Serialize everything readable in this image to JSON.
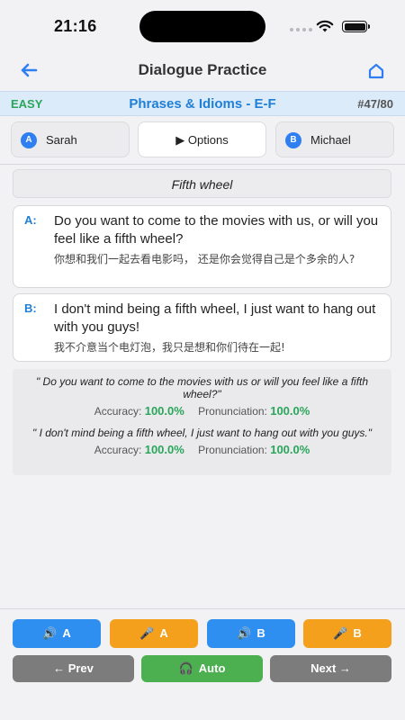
{
  "status": {
    "time": "21:16"
  },
  "header": {
    "title": "Dialogue Practice"
  },
  "level_bar": {
    "level": "EASY",
    "category": "Phrases & Idioms - E-F",
    "counter": "#47/80"
  },
  "tabs": {
    "a": {
      "badge": "A",
      "name": "Sarah"
    },
    "options": {
      "label": "▶ Options"
    },
    "b": {
      "badge": "B",
      "name": "Michael"
    }
  },
  "phrase": "Fifth wheel",
  "dialogue": [
    {
      "speaker": "A:",
      "english": "Do you want to come to the movies with us, or will you feel like a fifth wheel?",
      "chinese": "你想和我们一起去看电影吗， 还是你会觉得自己是个多余的人?"
    },
    {
      "speaker": "B:",
      "english": "I don't mind being a fifth wheel, I just want to hang out with you guys!",
      "chinese": "我不介意当个电灯泡，我只是想和你们待在一起!"
    }
  ],
  "results": [
    {
      "text": "\" Do you want to come to the movies with us or will you feel like a fifth wheel?\"",
      "accuracy_label": "Accuracy:",
      "accuracy": "100.0%",
      "pronunciation_label": "Pronunciation:",
      "pronunciation": "100.0%"
    },
    {
      "text": "\" I don't mind being a fifth wheel, I just want to hang out with you guys.\"",
      "accuracy_label": "Accuracy:",
      "accuracy": "100.0%",
      "pronunciation_label": "Pronunciation:",
      "pronunciation": "100.0%"
    }
  ],
  "controls": {
    "play_a": "A",
    "record_a": "A",
    "play_b": "B",
    "record_b": "B",
    "prev": "← Prev",
    "auto": "Auto",
    "next": "Next →"
  },
  "icons": {
    "speaker": "speaker-icon",
    "mic": "microphone-icon",
    "headphones": "headphones-icon",
    "back": "back-arrow-icon",
    "home": "home-icon"
  },
  "colors": {
    "accent_blue": "#2f8ff0",
    "accent_orange": "#f5a01c",
    "success_green": "#2aa65a",
    "auto_green": "#4caf50",
    "nav_gray": "#7c7c7c",
    "level_bar_bg": "#dcebfa"
  }
}
